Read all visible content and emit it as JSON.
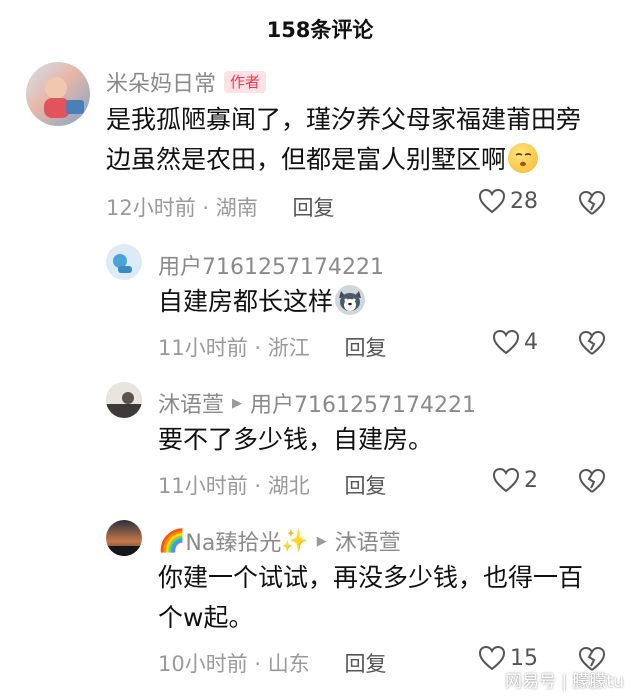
{
  "header": {
    "title": "158条评论"
  },
  "comments": [
    {
      "username": "米朵妈日常",
      "badge": "作者",
      "text_line1": "是我孤陋寡闻了，瑾汐养父母家福建莆田旁",
      "text_line2": "边虽然是农田，但都是富人别墅区啊",
      "emoji": "sleepy-face-icon",
      "time": "12小时前",
      "location": "湖南",
      "reply_label": "回复",
      "likes": "28"
    },
    {
      "username": "用户7161257174221",
      "text": "自建房都长这样",
      "emoji": "husky-face-icon",
      "time": "11小时前",
      "location": "浙江",
      "reply_label": "回复",
      "likes": "4"
    },
    {
      "username": "沐语萱",
      "reply_to": "用户7161257174221",
      "text": "要不了多少钱，自建房。",
      "time": "11小时前",
      "location": "湖北",
      "reply_label": "回复",
      "likes": "2"
    },
    {
      "username_prefix": "🌈",
      "username": "Na臻拾光",
      "username_suffix": "✨",
      "reply_to": "沐语萱",
      "text_line1": "你建一个试试，再没多少钱，也得一百",
      "text_line2": "个w起。",
      "time": "10小时前",
      "location": "山东",
      "reply_label": "回复",
      "likes": "15"
    }
  ],
  "separator": "·",
  "watermark": "网易号 | 朦朦tu",
  "colors": {
    "username": "#8a8a8a",
    "badge_bg": "#fde2e6",
    "badge_text": "#f2394d",
    "meta": "#9a9a9a"
  }
}
